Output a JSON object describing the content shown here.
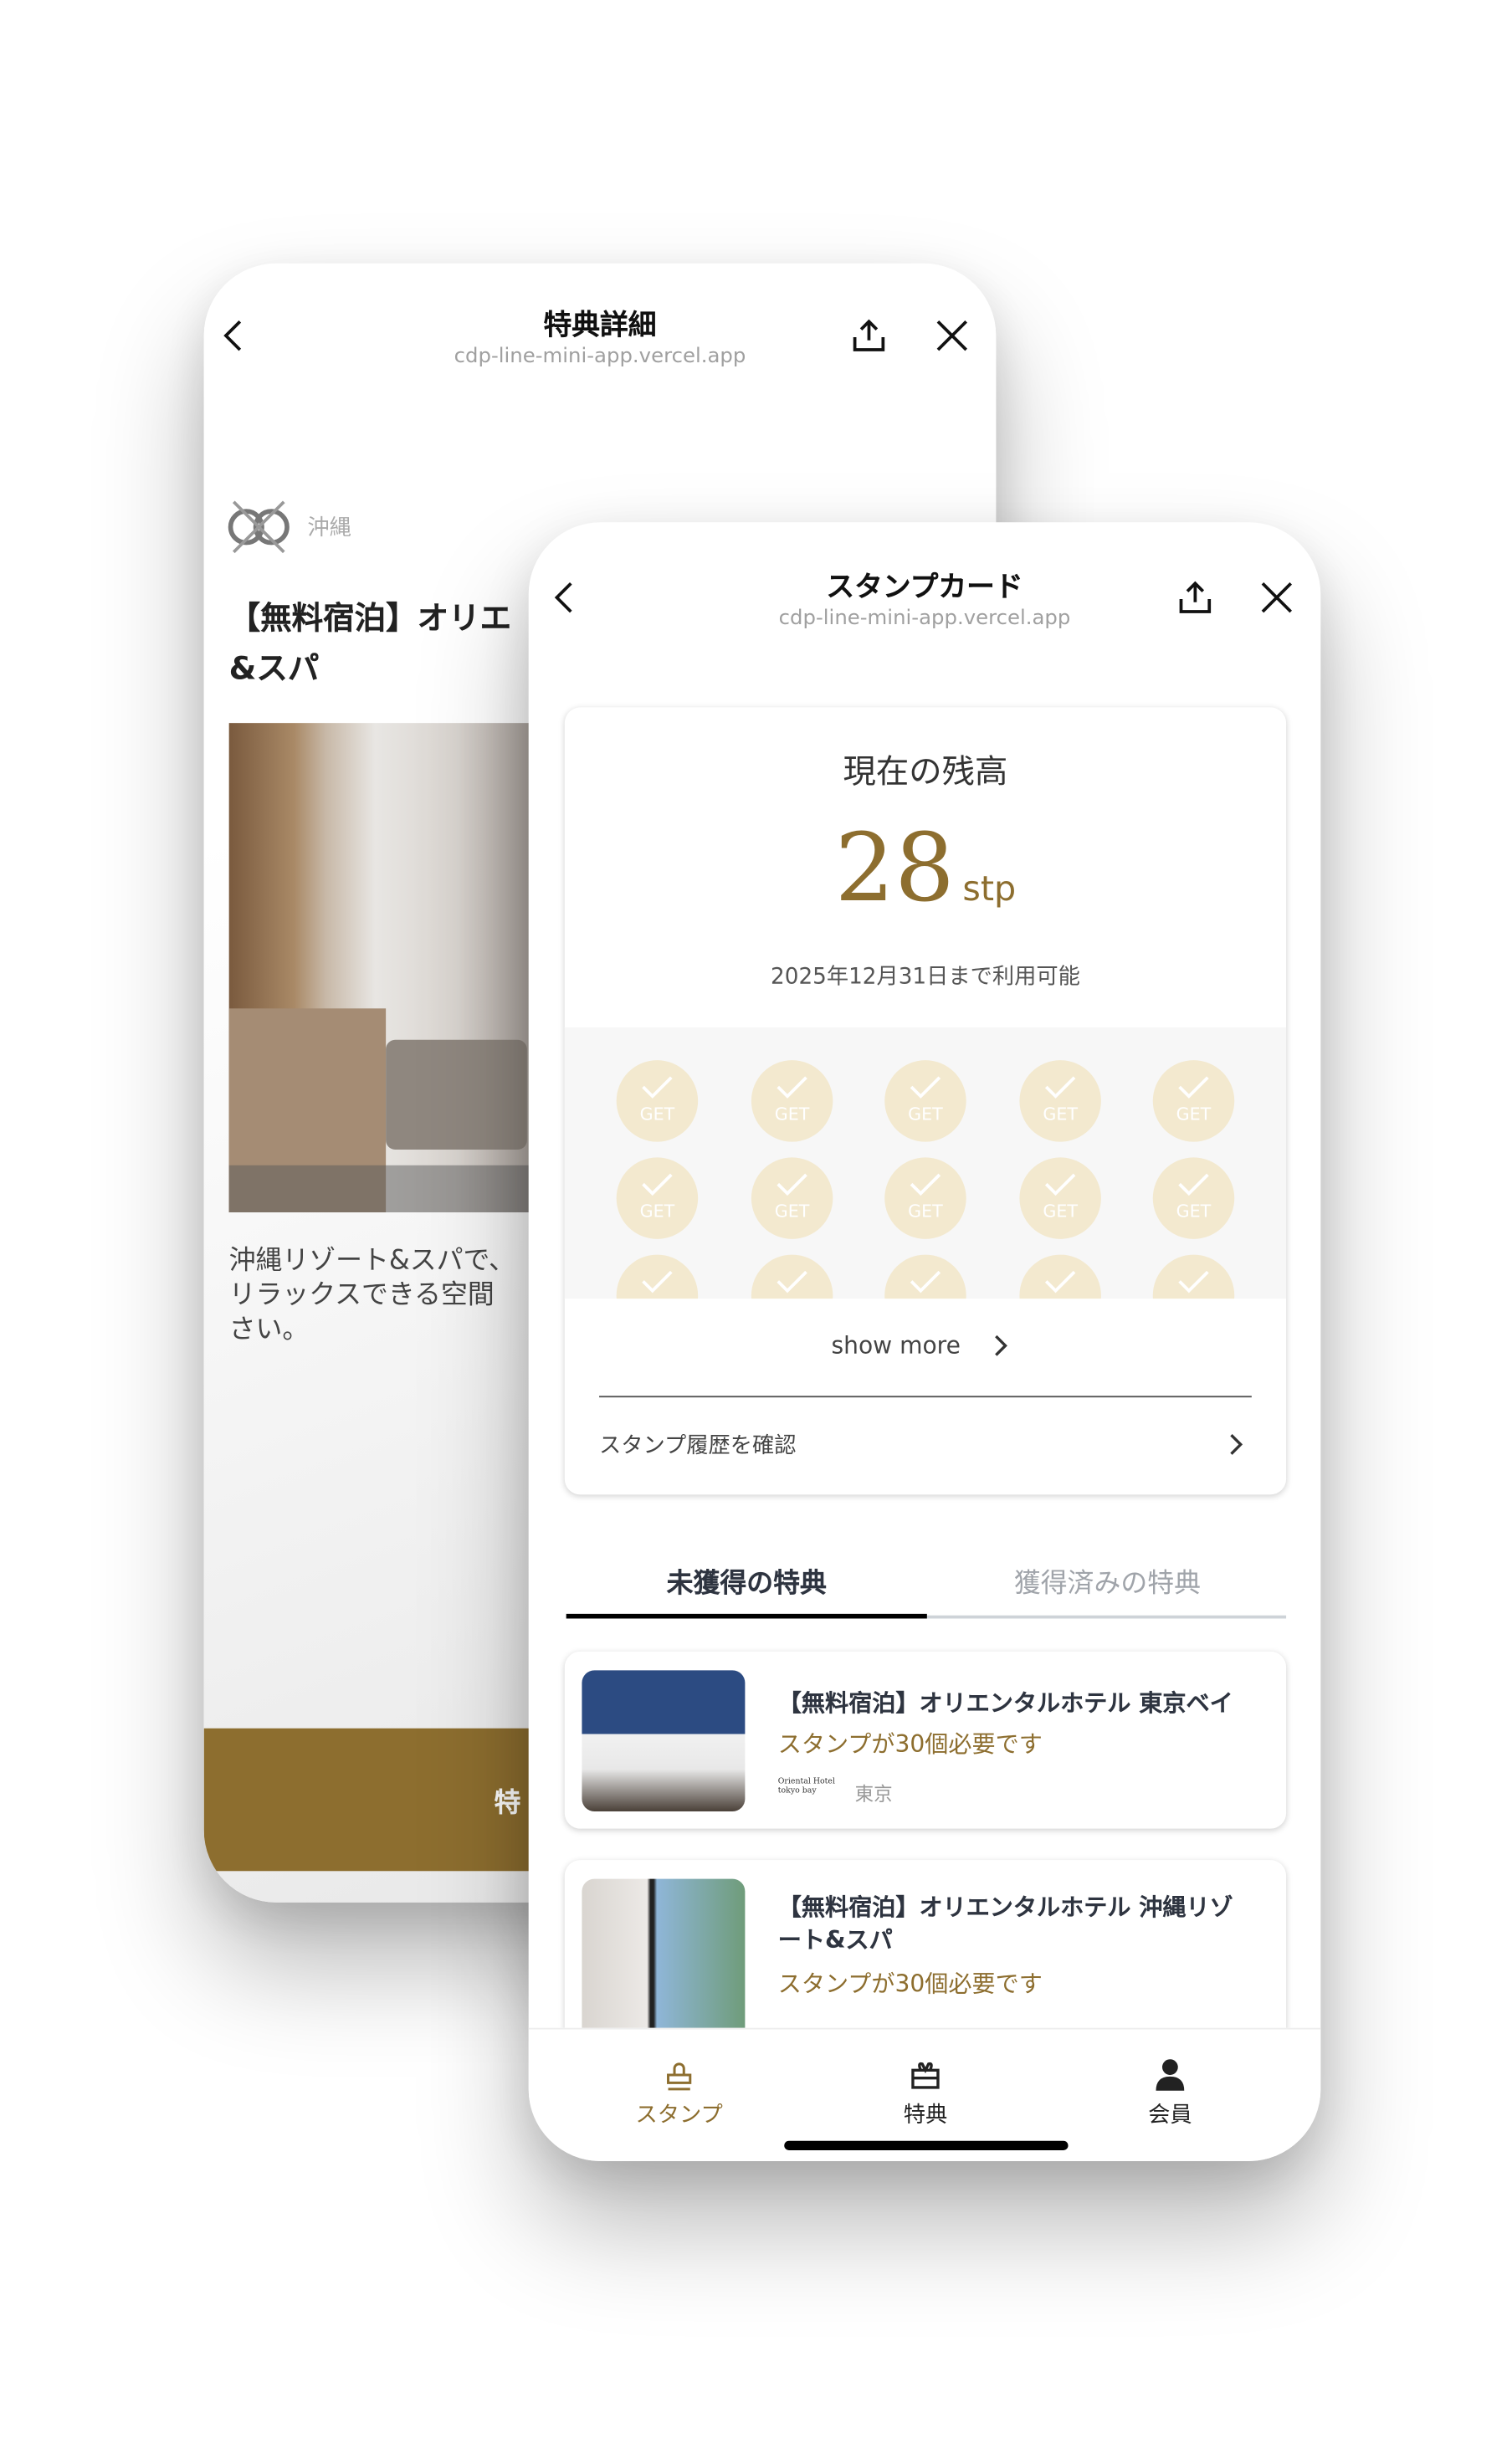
{
  "back_screen": {
    "title": "特典詳細",
    "url": "cdp-line-mini-app.vercel.app",
    "region": "沖縄",
    "title_line1": "【無料宿泊】オリエ",
    "title_line2": "&スパ",
    "desc_line1": "沖縄リゾート&スパで、",
    "desc_line2": "リラックスできる空間",
    "desc_line3": "さい。",
    "cta_label": "特"
  },
  "front_screen": {
    "title": "スタンプカード",
    "url": "cdp-line-mini-app.vercel.app",
    "balance_label": "現在の残高",
    "balance_value": "28",
    "balance_unit": "stp",
    "expiry": "2025年12月31日まで利用可能",
    "stamp_label": "GET",
    "show_more": "show more",
    "history_link": "スタンプ履歴を確認",
    "tabs": [
      {
        "label": "未獲得の特典",
        "active": true
      },
      {
        "label": "獲得済みの特典",
        "active": false
      }
    ],
    "rewards": [
      {
        "title": "【無料宿泊】オリエンタルホテル 東京ベイ",
        "requirement": "スタンプが30個必要です",
        "logo_text": "Oriental Hotel tokyo bay",
        "region": "東京"
      },
      {
        "title_line1": "【無料宿泊】オリエンタルホテル 沖縄リゾ",
        "title_line2": "ート&スパ",
        "requirement": "スタンプが30個必要です"
      }
    ],
    "nav": [
      {
        "label": "スタンプ",
        "icon": "stamp-icon",
        "active": true
      },
      {
        "label": "特典",
        "icon": "gift-icon",
        "active": false
      },
      {
        "label": "会員",
        "icon": "person-icon",
        "active": false
      }
    ]
  },
  "colors": {
    "accent": "#8d6e2f",
    "stamp": "#f3e9cf",
    "cta": "#8d6e2f"
  }
}
